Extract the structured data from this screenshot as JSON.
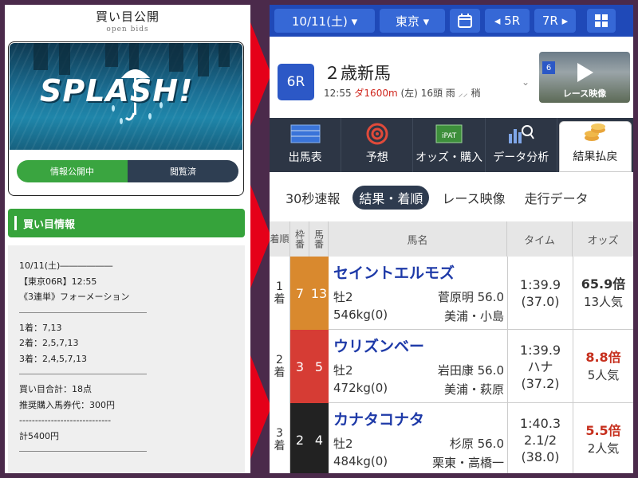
{
  "left": {
    "title": "買い目公開",
    "subtitle": "open bids",
    "banner_text": "SPLASH!",
    "toggle": {
      "active": "情報公開中",
      "inactive": "閲覧済"
    },
    "info_heading": "買い目情報",
    "info_lines": {
      "date": "10/11(土)――――――",
      "race": "【東京06R】12:55",
      "bet_type": "《3連単》フォーメーション",
      "first": "1着：7,13",
      "second": "2着：2,5,7,13",
      "third": "3着：2,4,5,7,13",
      "total_points": "買い目合計：18点",
      "recommended": "推奨購入馬券代：300円",
      "dashes": "-----------------------------",
      "total": "計5400円"
    }
  },
  "right": {
    "nav": {
      "date": "10/11(土) ▾",
      "venue": "東京 ▾",
      "prev": "◂ 5R",
      "next": "7R ▸"
    },
    "race": {
      "badge": "6R",
      "name": "２歳新馬",
      "time": "12:55",
      "course": "ダ1600m",
      "dir": "(左)",
      "runners": "16頭",
      "weather": "雨",
      "going": "稍",
      "video_label": "レース映像",
      "video_badge": "6"
    },
    "tabs": [
      {
        "label": "出馬表",
        "icon": "entries-table-icon"
      },
      {
        "label": "予想",
        "icon": "target-icon"
      },
      {
        "label": "オッズ・購入",
        "icon": "ipat-terminal-icon"
      },
      {
        "label": "データ分析",
        "icon": "chart-search-icon"
      },
      {
        "label": "結果払戻",
        "icon": "coins-icon"
      }
    ],
    "subtabs": [
      "30秒速報",
      "結果・着順",
      "レース映像",
      "走行データ"
    ],
    "table": {
      "headers": {
        "rank": "着順",
        "waku": "枠番",
        "umaban": "馬番",
        "name": "馬名",
        "time": "タイム",
        "odds": "オッズ"
      },
      "rows": [
        {
          "rank": "1",
          "rank_unit": "着",
          "waku": "7",
          "umaban": "13",
          "name": "セイントエルモズ",
          "sexage": "牡2",
          "jockey": "菅原明 56.0",
          "weight": "546kg(0)",
          "trainer": "美浦・小島",
          "time": "1:39.9",
          "margin": "",
          "last3f": "(37.0)",
          "odds": "65.9倍",
          "pop": "13人気",
          "waku_color": "#d9892e",
          "odds_red": false
        },
        {
          "rank": "2",
          "rank_unit": "着",
          "waku": "3",
          "umaban": "5",
          "name": "ウリズンベー",
          "sexage": "牡2",
          "jockey": "岩田康 56.0",
          "weight": "472kg(0)",
          "trainer": "美浦・萩原",
          "time": "1:39.9",
          "margin": "ハナ",
          "last3f": "(37.2)",
          "odds": "8.8倍",
          "pop": "5人気",
          "waku_color": "#d63c34",
          "odds_red": true
        },
        {
          "rank": "3",
          "rank_unit": "着",
          "waku": "2",
          "umaban": "4",
          "name": "カナタコナタ",
          "sexage": "牡2",
          "jockey": "杉原 56.0",
          "weight": "484kg(0)",
          "trainer": "栗東・高橋一",
          "time": "1:40.3",
          "margin": "2.1/2",
          "last3f": "(38.0)",
          "odds": "5.5倍",
          "pop": "2人気",
          "waku_color": "#222222",
          "odds_red": true
        }
      ]
    }
  },
  "colors": {
    "nav": "#1f49b8",
    "accent_green": "#36a33b",
    "arrow_red": "#e50019",
    "frame": "#4b2a4b"
  }
}
